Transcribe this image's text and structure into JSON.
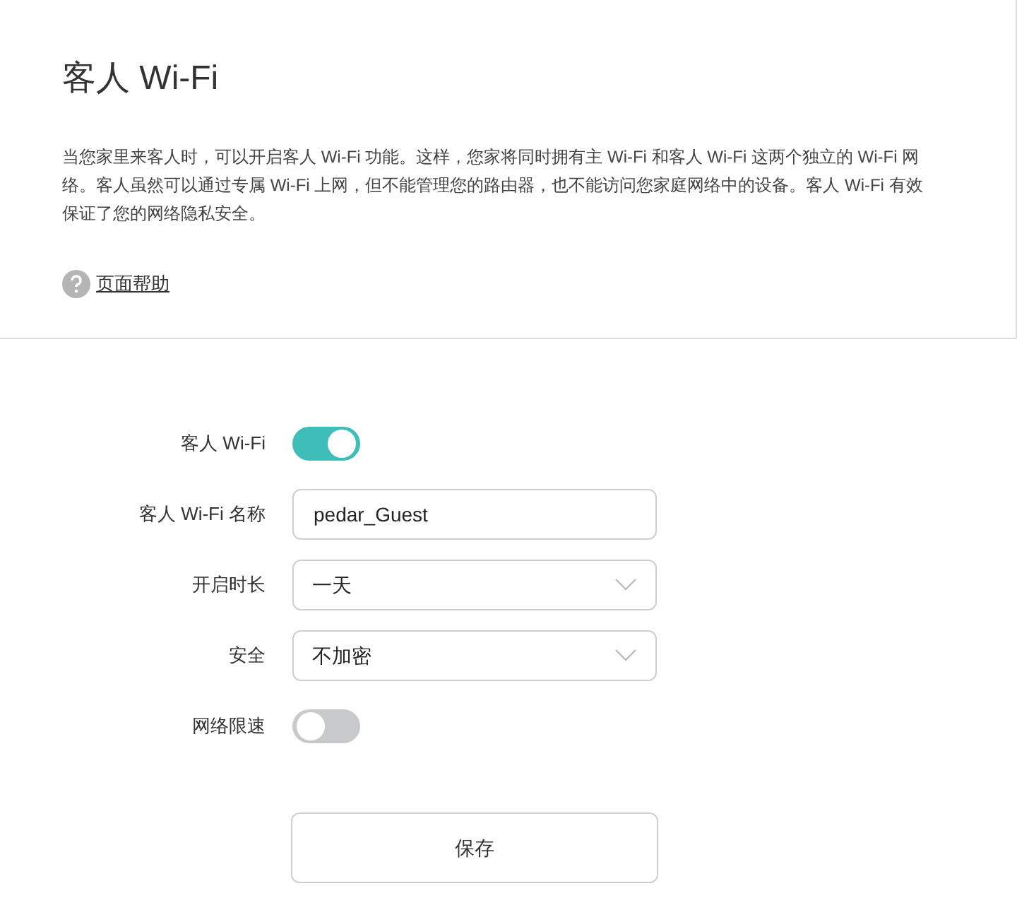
{
  "title": "客人 Wi-Fi",
  "description": "当您家里来客人时，可以开启客人 Wi-Fi 功能。这样，您家将同时拥有主 Wi-Fi 和客人 Wi-Fi 这两个独立的 Wi-Fi 网络。客人虽然可以通过专属 Wi-Fi 上网，但不能管理您的路由器，也不能访问您家庭网络中的设备。客人 Wi-Fi 有效保证了您的网络隐私安全。",
  "help_link": "页面帮助",
  "fields": [
    {
      "kind": "toggle",
      "label": "客人 Wi-Fi",
      "on": true
    },
    {
      "kind": "text",
      "label": "客人 Wi-Fi 名称",
      "value": "pedar_Guest"
    },
    {
      "kind": "select",
      "label": "开启时长",
      "value": "一天"
    },
    {
      "kind": "select",
      "label": "安全",
      "value": "不加密"
    },
    {
      "kind": "toggle",
      "label": "网络限速",
      "on": false
    }
  ],
  "save_button": "保存"
}
